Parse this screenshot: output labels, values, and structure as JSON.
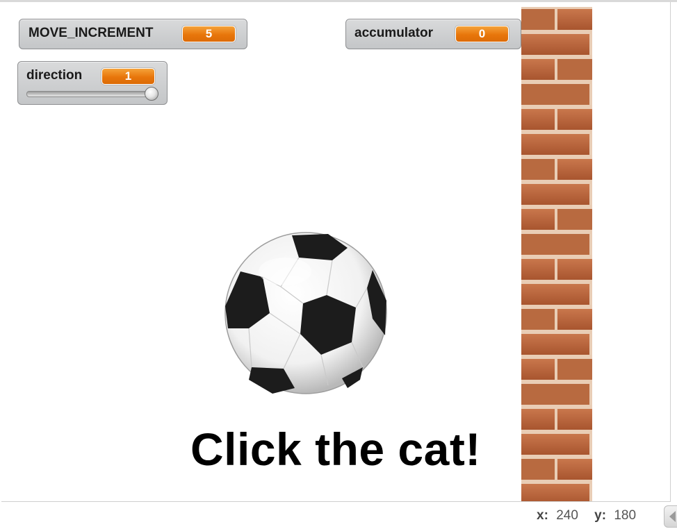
{
  "stage": {
    "monitors": [
      {
        "name": "MOVE_INCREMENT",
        "value": "5"
      },
      {
        "name": "accumulator",
        "value": "0"
      },
      {
        "name": "direction",
        "value": "1",
        "slider_level": 1.0
      }
    ],
    "message": "Click the cat!",
    "sprites": [
      "soccer-ball",
      "brick-wall"
    ]
  },
  "status_bar": {
    "x_label": "x:",
    "x_value": "240",
    "y_label": "y:",
    "y_value": "180"
  },
  "colors": {
    "monitor_value": "#e8760b",
    "brick": "#b5643a",
    "mortar": "#e9cdb5",
    "text": "#000000"
  }
}
